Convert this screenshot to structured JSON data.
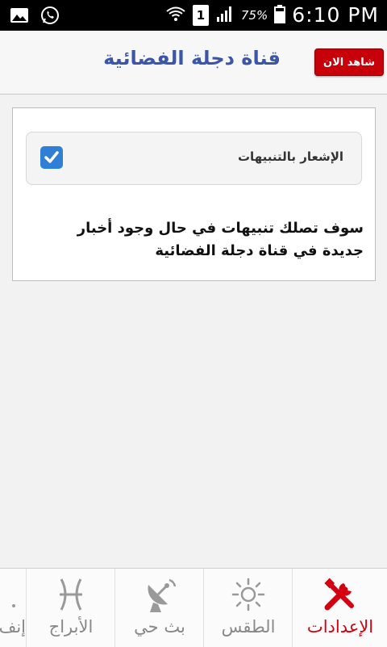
{
  "status_bar": {
    "battery": "75%",
    "time": "6:10 PM",
    "sim": "1"
  },
  "header": {
    "title": "قناة دجلة الفضائية",
    "watch_button": "شاهد الان"
  },
  "settings": {
    "notifications_label": "الإشعار بالتنبيهات",
    "notifications_enabled": true,
    "description": "سوف تصلك تنبيهات في حال وجود أخبار جديدة في قناة دجلة الفضائية"
  },
  "tabs": [
    {
      "label": "الإعدادات",
      "icon": "settings-tools-icon",
      "active": true
    },
    {
      "label": "الطقس",
      "icon": "sun-icon",
      "active": false
    },
    {
      "label": "بث حي",
      "icon": "satellite-dish-icon",
      "active": false
    },
    {
      "label": "الأبراج",
      "icon": "pisces-icon",
      "active": false
    },
    {
      "label": "إنف",
      "icon": "info-icon",
      "active": false
    }
  ],
  "colors": {
    "accent": "#d40010",
    "title": "#3b55a8",
    "checkbox": "#2f7fd6"
  }
}
